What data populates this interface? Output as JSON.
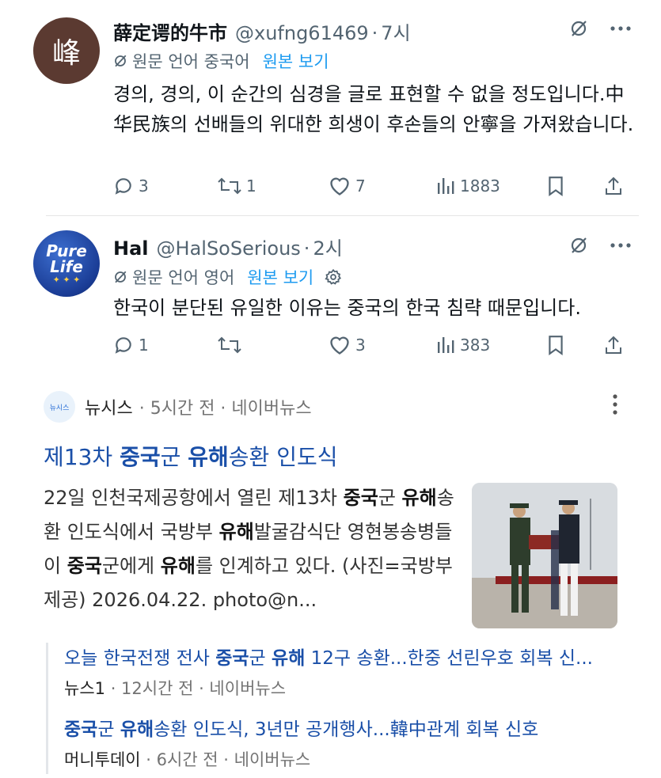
{
  "tweet1": {
    "avatar_char": "峰",
    "name": "薛定谔的牛市",
    "handle": "@xufng61469",
    "dot": "·",
    "time": "7시",
    "trans_label": "원문 언어 중국어",
    "trans_link": "원본 보기",
    "text": "경의, 경의, 이 순간의 심경을 글로 표현할 수 없을 정도입니다.中华民族의 선배들의 위대한 희생이 후손들의 안寧을 가져왔습니다.",
    "replies": "3",
    "reposts": "1",
    "likes": "7",
    "views": "1883"
  },
  "tweet2": {
    "avatar_text1": "Pure",
    "avatar_text2": "Life",
    "name": "Hal",
    "handle": "@HalSoSerious",
    "dot": "·",
    "time": "2시",
    "trans_label": "원문 언어 영어",
    "trans_link": "원본 보기",
    "text": "한국이 분단된 유일한 이유는 중국의 한국 침략 때문입니다.",
    "replies": "1",
    "reposts": "",
    "likes": "3",
    "views": "383"
  },
  "news": {
    "logo_text": "뉴시스",
    "source": "뉴시스",
    "meta": "· 5시간 전 · 네이버뉴스",
    "title_pre": "제13차 ",
    "title_b1": "중국",
    "title_mid": "군 ",
    "title_b2": "유해",
    "title_post": "송환 인도식",
    "desc": [
      {
        "t": "22일 인천국제공항에서 열린 제13차 "
      },
      {
        "b": "중국"
      },
      {
        "t": "군 "
      },
      {
        "b": "유해"
      },
      {
        "t": "송환 인도식에서 국방부 "
      },
      {
        "b": "유해"
      },
      {
        "t": "발굴감식단 영현봉송병들이 "
      },
      {
        "b": "중국"
      },
      {
        "t": "군에게 "
      },
      {
        "b": "유해"
      },
      {
        "t": "를 인계하고 있다. (사진=국방부 제공) 2026.04.22. photo@n..."
      }
    ],
    "related": [
      {
        "parts": [
          {
            "t": "오늘 한국전쟁 전사 "
          },
          {
            "b": "중국"
          },
          {
            "t": "군 "
          },
          {
            "b": "유해"
          },
          {
            "t": " 12구 송환...한중 선린우호 회복 신..."
          }
        ],
        "source": "뉴스1",
        "meta": " · 12시간 전 · 네이버뉴스"
      },
      {
        "parts": [
          {
            "b": "중국"
          },
          {
            "t": "군 "
          },
          {
            "b": "유해"
          },
          {
            "t": "송환 인도식, 3년만 공개행사...韓中관계 회복 신호"
          }
        ],
        "source": "머니투데이",
        "meta": " · 6시간 전 · 네이버뉴스"
      }
    ]
  },
  "colors": {
    "text": "#0f1419",
    "secondary": "#536471",
    "link": "#1d9bf0",
    "news_link": "#1a4fa8"
  },
  "icons": [
    "reply-icon",
    "repost-icon",
    "like-icon",
    "views-icon",
    "bookmark-icon",
    "share-icon",
    "grok-icon",
    "more-icon",
    "translate-icon",
    "settings-icon",
    "kebab-icon"
  ]
}
